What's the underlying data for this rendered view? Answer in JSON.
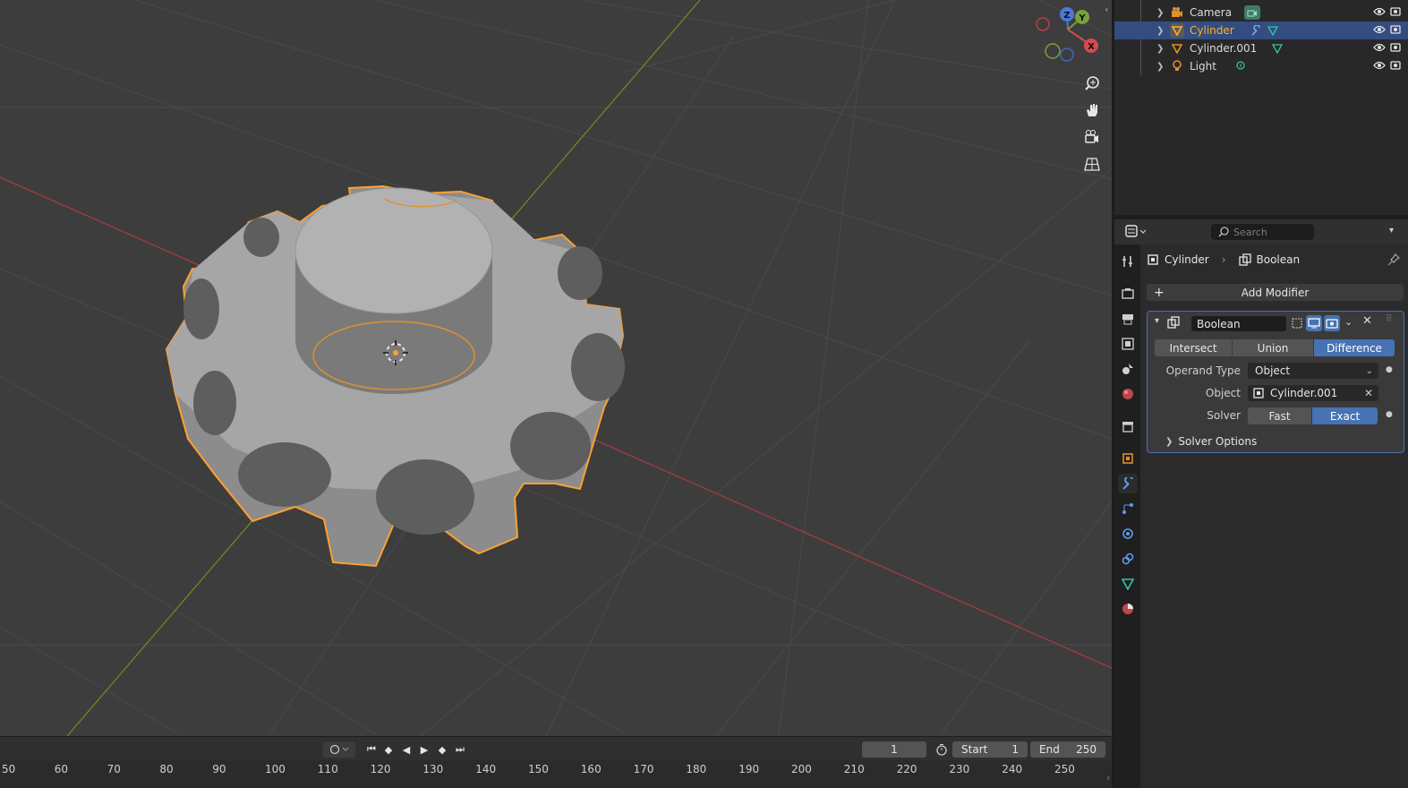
{
  "outliner": {
    "items": [
      {
        "name": "Camera",
        "icon": "camera-icon",
        "extra": "camera-data-icon",
        "selected": false
      },
      {
        "name": "Cylinder",
        "icon": "mesh-object-icon",
        "extra": "modifier-wrench-icon",
        "selected": true
      },
      {
        "name": "Cylinder.001",
        "icon": "mesh-object-icon",
        "extra": "mesh-data-icon",
        "selected": false
      },
      {
        "name": "Light",
        "icon": "light-icon",
        "extra": "light-data-icon",
        "selected": false
      }
    ]
  },
  "properties": {
    "search_placeholder": "Search",
    "breadcrumb": {
      "object": "Cylinder",
      "modifier": "Boolean"
    },
    "add_modifier_label": "Add Modifier",
    "modifier": {
      "name": "Boolean",
      "operations": [
        "Intersect",
        "Union",
        "Difference"
      ],
      "active_operation": "Difference",
      "operand_type_label": "Operand Type",
      "operand_type_value": "Object",
      "object_label": "Object",
      "object_value": "Cylinder.001",
      "solver_label": "Solver",
      "solver_options": [
        "Fast",
        "Exact"
      ],
      "active_solver": "Exact",
      "solver_options_label": "Solver Options"
    }
  },
  "gizmo": {
    "z": "Z",
    "y": "Y",
    "x": "X"
  },
  "timeline": {
    "current_frame": "1",
    "start_label": "Start",
    "start_value": "1",
    "end_label": "End",
    "end_value": "250",
    "ruler_ticks": [
      "50",
      "60",
      "70",
      "80",
      "90",
      "100",
      "110",
      "120",
      "130",
      "140",
      "150",
      "160",
      "170",
      "180",
      "190",
      "200",
      "210",
      "220",
      "230",
      "240",
      "250"
    ]
  },
  "colors": {
    "selection_outline": "#ffa031",
    "accent_blue": "#4772b3",
    "x_axis": "#c53a3f",
    "y_axis": "#6f8e25"
  }
}
